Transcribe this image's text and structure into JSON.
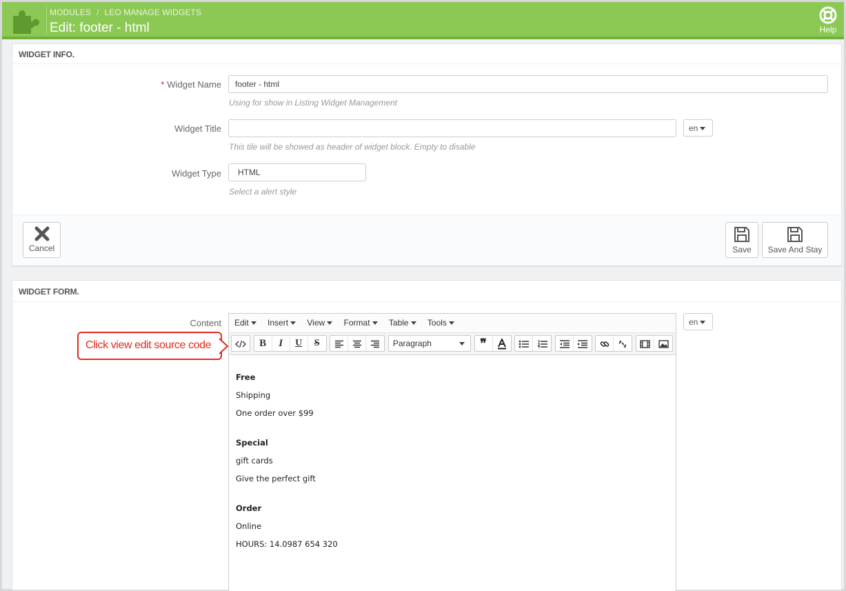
{
  "header": {
    "breadcrumb": [
      "MODULES",
      "LEO MANAGE WIDGETS"
    ],
    "title": "Edit: footer - html",
    "help_label": "Help"
  },
  "widget_info": {
    "heading": "WIDGET INFO.",
    "name": {
      "required_mark": "*",
      "label": "Widget Name",
      "value": "footer - html",
      "help": "Using for show in Listing Widget Management"
    },
    "title": {
      "label": "Widget Title",
      "value": "",
      "lang": "en",
      "help": "This tile will be showed as header of widget block. Empty to disable"
    },
    "type": {
      "label": "Widget Type",
      "value": "HTML",
      "help": "Select a alert style"
    },
    "buttons": {
      "cancel": "Cancel",
      "save": "Save",
      "save_stay": "Save And Stay"
    }
  },
  "widget_form": {
    "heading": "WIDGET FORM.",
    "content_label": "Content",
    "lang": "en",
    "menu": [
      "Edit",
      "Insert",
      "View",
      "Format",
      "Table",
      "Tools"
    ],
    "format_select": "Paragraph",
    "body": [
      {
        "text": "Free",
        "bold": true
      },
      {
        "text": "Shipping",
        "bold": false
      },
      {
        "text": "One order over $99",
        "bold": false
      },
      {
        "text": "Special",
        "bold": true
      },
      {
        "text": "gift cards",
        "bold": false
      },
      {
        "text": "Give the perfect gift",
        "bold": false
      },
      {
        "text": "Order",
        "bold": true
      },
      {
        "text": "Online",
        "bold": false
      },
      {
        "text": "HOURS: 14.0987 654 320",
        "bold": false
      }
    ]
  },
  "annotation": {
    "callout_text": "Click view edit source code"
  },
  "colors": {
    "header_bg": "#8bc954",
    "accent_red": "#e1291f"
  }
}
